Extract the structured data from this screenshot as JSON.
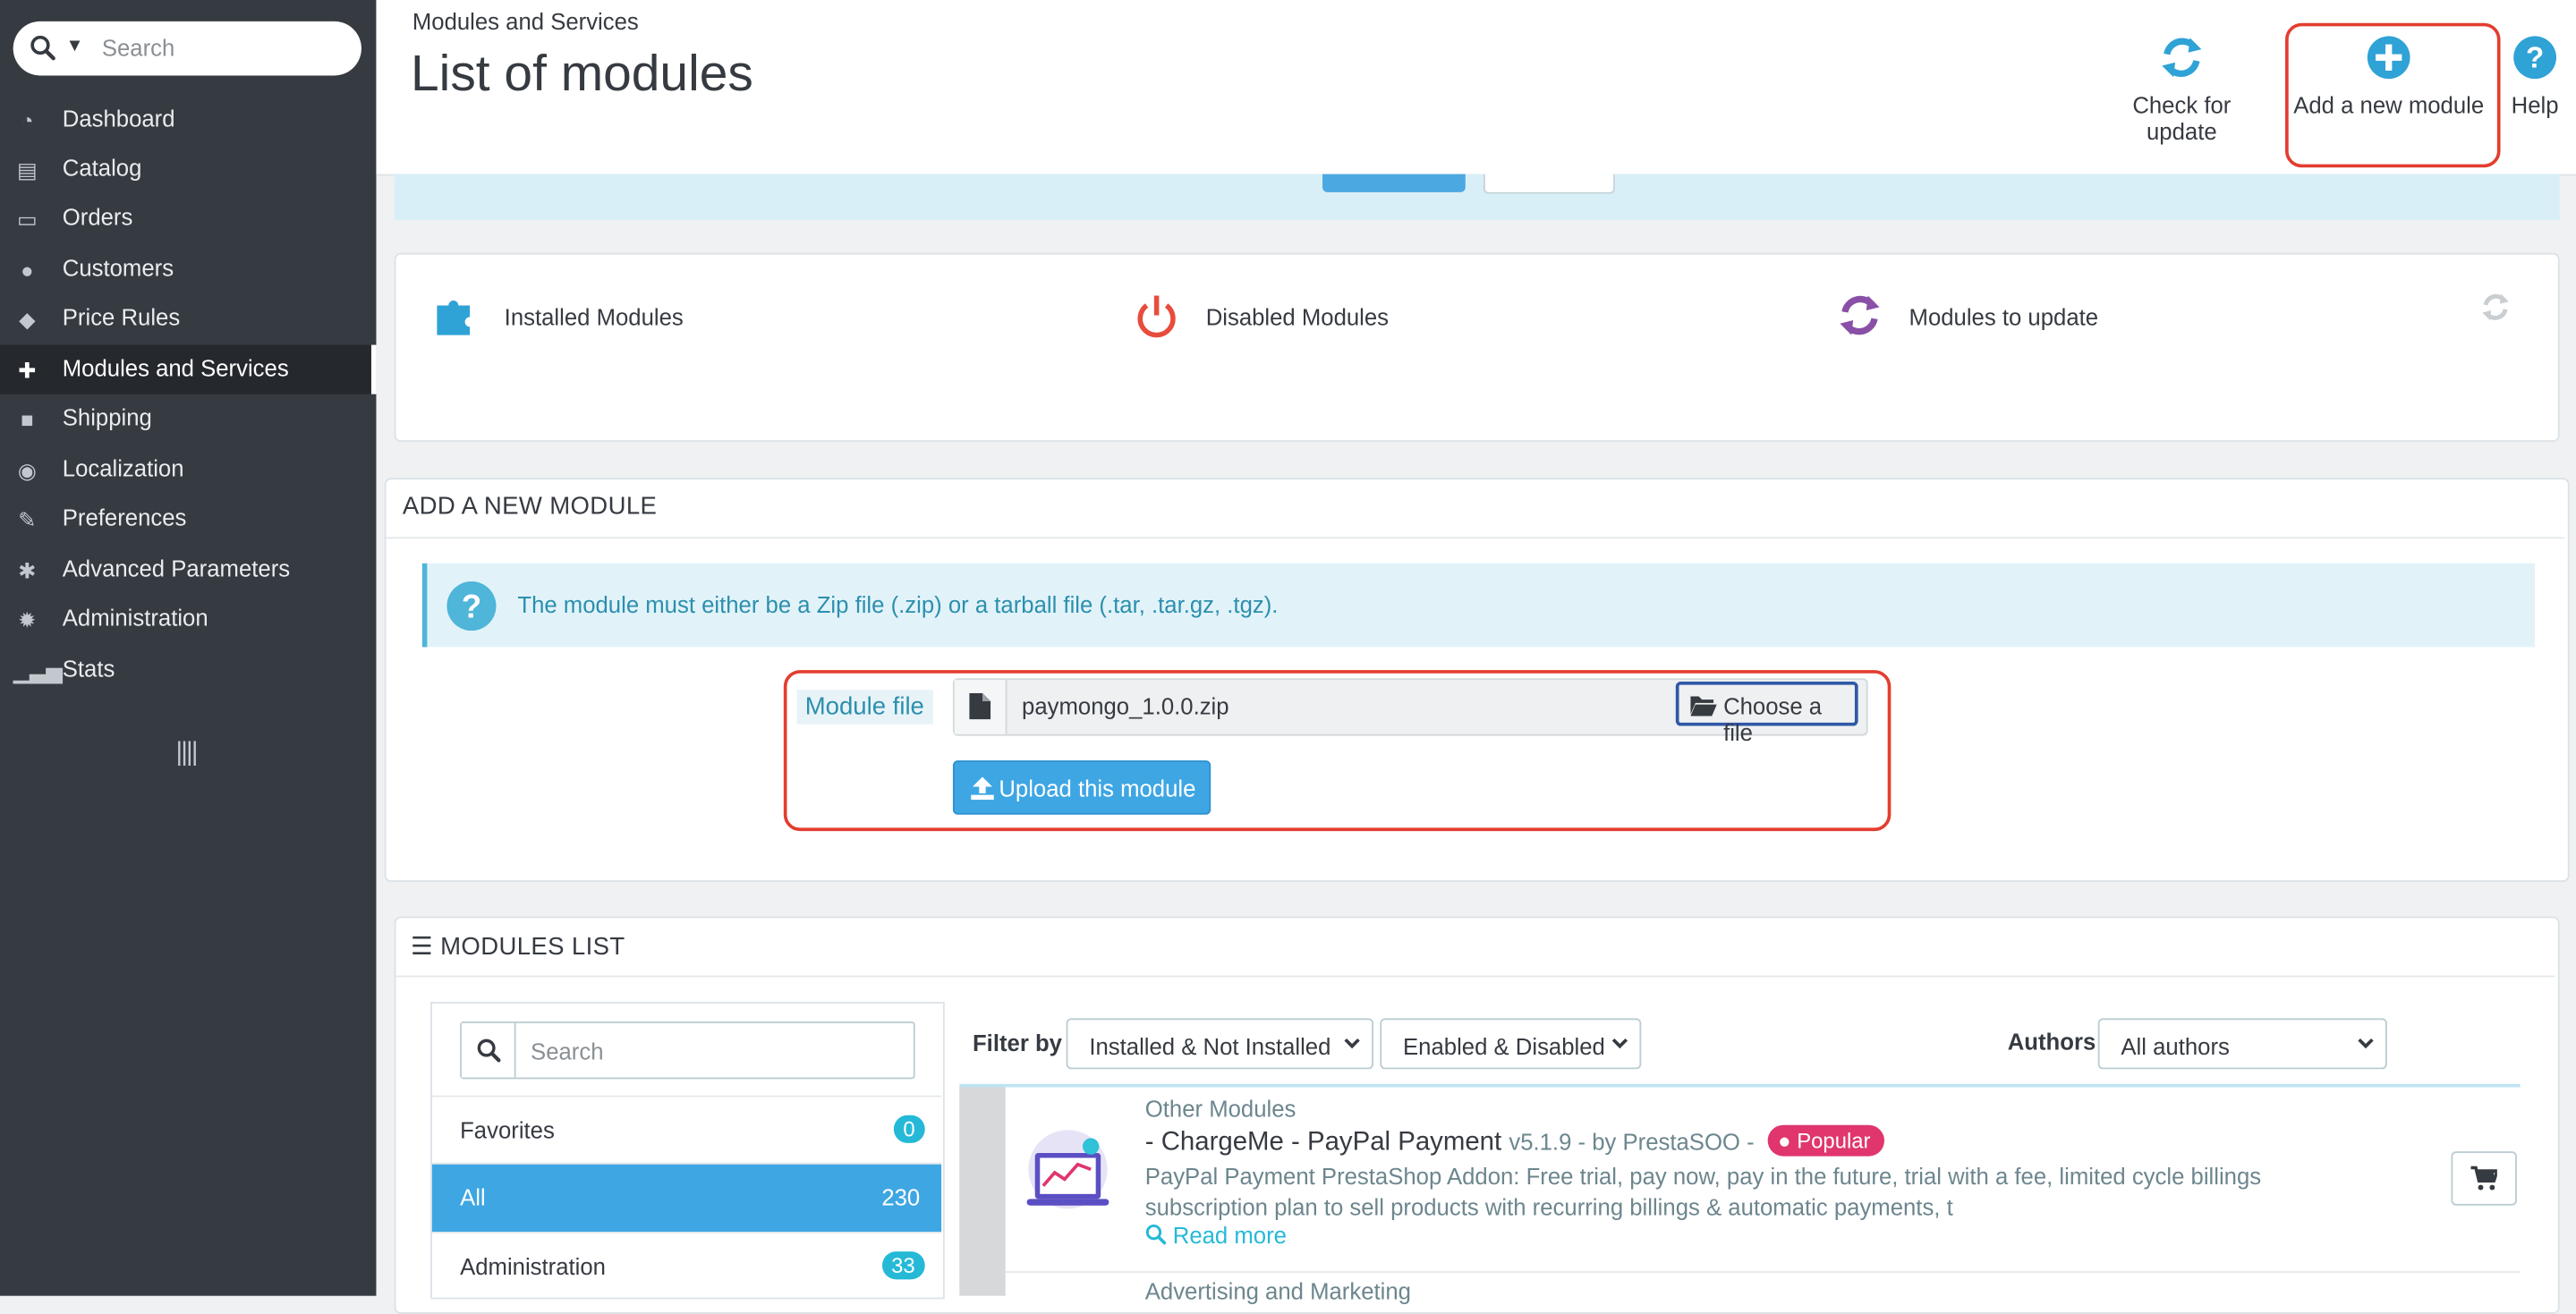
{
  "sidebar": {
    "search_placeholder": "Search",
    "items": [
      {
        "label": "Dashboard",
        "icon": "dashboard-icon"
      },
      {
        "label": "Catalog",
        "icon": "catalog-icon"
      },
      {
        "label": "Orders",
        "icon": "orders-icon"
      },
      {
        "label": "Customers",
        "icon": "customers-icon"
      },
      {
        "label": "Price Rules",
        "icon": "tags-icon"
      },
      {
        "label": "Modules and Services",
        "icon": "puzzle-icon",
        "active": true
      },
      {
        "label": "Shipping",
        "icon": "truck-icon"
      },
      {
        "label": "Localization",
        "icon": "globe-icon"
      },
      {
        "label": "Preferences",
        "icon": "wrench-icon"
      },
      {
        "label": "Advanced Parameters",
        "icon": "cogs-icon"
      },
      {
        "label": "Administration",
        "icon": "gear-icon"
      },
      {
        "label": "Stats",
        "icon": "bar-chart-icon"
      }
    ]
  },
  "header": {
    "breadcrumb": "Modules and Services",
    "title": "List of modules",
    "toolbar": {
      "check_update": "Check for update",
      "add_module": "Add a new module",
      "help": "Help"
    }
  },
  "status_panel": {
    "installed": "Installed Modules",
    "disabled": "Disabled Modules",
    "to_update": "Modules to update"
  },
  "add_module": {
    "section_title": "ADD A NEW MODULE",
    "info": "The module must either be a Zip file (.zip) or a tarball file (.tar, .tar.gz, .tgz).",
    "file_label": "Module file",
    "file_name": "paymongo_1.0.0.zip",
    "choose_label": "Choose a file",
    "upload_label": "Upload this module"
  },
  "modules_list": {
    "section_title": "MODULES LIST",
    "search_placeholder": "Search",
    "categories": [
      {
        "label": "Favorites",
        "count": "0"
      },
      {
        "label": "All",
        "count": "230",
        "active": true
      },
      {
        "label": "Administration",
        "count": "33"
      }
    ],
    "filter_label": "Filter by",
    "filter_install": "Installed & Not Installed",
    "filter_enable": "Enabled & Disabled",
    "authors_label": "Authors",
    "authors_value": "All authors",
    "module": {
      "category": "Other Modules",
      "name": "- ChargeMe - PayPal Payment",
      "meta": "v5.1.9 - by PrestaSOO -",
      "badge": "Popular",
      "description": "PayPal Payment PrestaShop Addon: Free trial, pay now, pay in the future, trial with a fee, limited cycle billings subscription plan to sell products with recurring billings & automatic payments, t",
      "read_more": "Read more"
    },
    "next_category": "Advertising and Marketing"
  },
  "colors": {
    "sidebar_bg": "#363a41",
    "accent": "#25b9d7",
    "primary_button": "#3ea6e3",
    "highlight": "#e33d2f",
    "popular_badge": "#e0366d"
  }
}
